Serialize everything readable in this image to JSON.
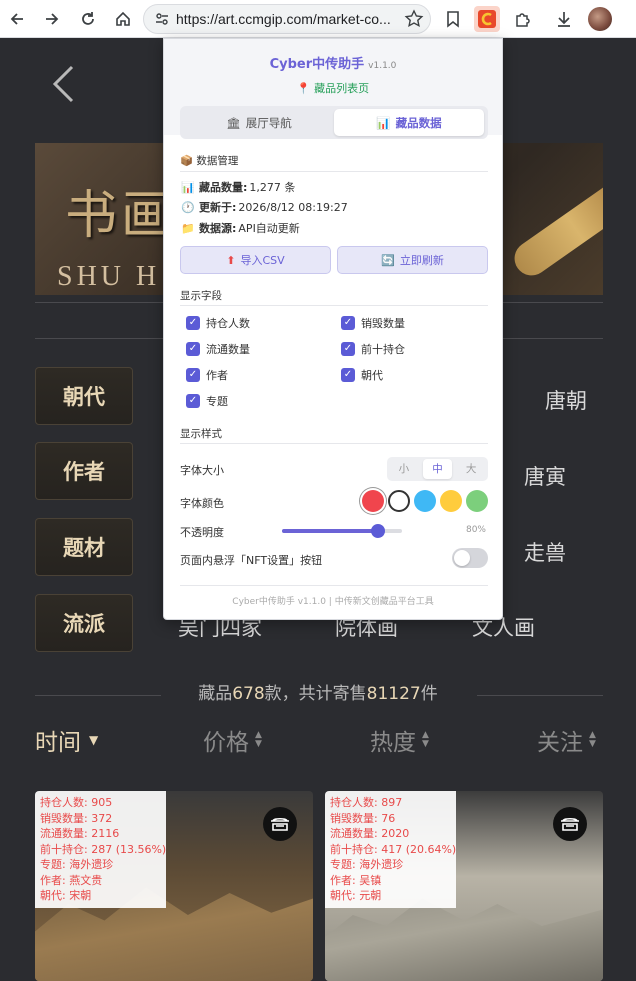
{
  "browser": {
    "url": "https://art.ccmgip.com/market-co..."
  },
  "page": {
    "banner_title": "书画",
    "banner_subtitle": "SHU H",
    "categories": [
      {
        "label": "朝代",
        "right": "唐朝"
      },
      {
        "label": "作者",
        "right": "唐寅"
      },
      {
        "label": "题材",
        "right": "走兽"
      },
      {
        "label": "流派",
        "options": [
          "吴门四家",
          "院体画",
          "文人画"
        ]
      }
    ],
    "summary": {
      "prefix": "藏品",
      "count": "678",
      "mid": "款，共计寄售",
      "total": "81127",
      "suffix": "件"
    },
    "sort": [
      "时间",
      "价格",
      "热度",
      "关注"
    ],
    "cards": [
      {
        "lines": [
          "持仓人数: 905",
          "销毁数量: 372",
          "流通数量: 2116",
          "前十持仓: 287 (13.56%)",
          "专题: 海外遗珍",
          "作者: 燕文贵",
          "朝代: 宋朝"
        ]
      },
      {
        "lines": [
          "持仓人数: 897",
          "销毁数量: 76",
          "流通数量: 2020",
          "前十持仓: 417 (20.64%)",
          "专题: 海外遗珍",
          "作者: 吴镇",
          "朝代: 元朝"
        ]
      }
    ],
    "overlay_color": "#e84a4a"
  },
  "popup": {
    "title": "Cyber中传助手",
    "version": "v1.1.0",
    "current_page": "藏品列表页",
    "tabs": [
      "展厅导航",
      "藏品数据"
    ],
    "data_section": "数据管理",
    "info": {
      "count_label": "藏品数量:",
      "count_value": "1,277 条",
      "updated_label": "更新于:",
      "updated_value": "2026/8/12 08:19:27",
      "source_label": "数据源:",
      "source_value": "API自动更新"
    },
    "buttons": {
      "import": "导入CSV",
      "refresh": "立即刷新"
    },
    "fields_section": "显示字段",
    "fields": [
      "持仓人数",
      "销毁数量",
      "流通数量",
      "前十持仓",
      "作者",
      "朝代",
      "专题"
    ],
    "style_section": "显示样式",
    "font_size_label": "字体大小",
    "font_sizes": [
      "小",
      "中",
      "大"
    ],
    "font_size_selected": "中",
    "font_color_label": "字体颜色",
    "colors": [
      "#f0454d",
      "#ffffff",
      "#3fb8f5",
      "#ffcc3d",
      "#7ccf7c"
    ],
    "opacity_label": "不透明度",
    "opacity_value": "80%",
    "opacity": 0.8,
    "float_label": "页面内悬浮「NFT设置」按钮",
    "float_enabled": false,
    "footer": "Cyber中传助手 v1.1.0 | 中传新文创藏品平台工具",
    "accent": "#6b63d6"
  }
}
